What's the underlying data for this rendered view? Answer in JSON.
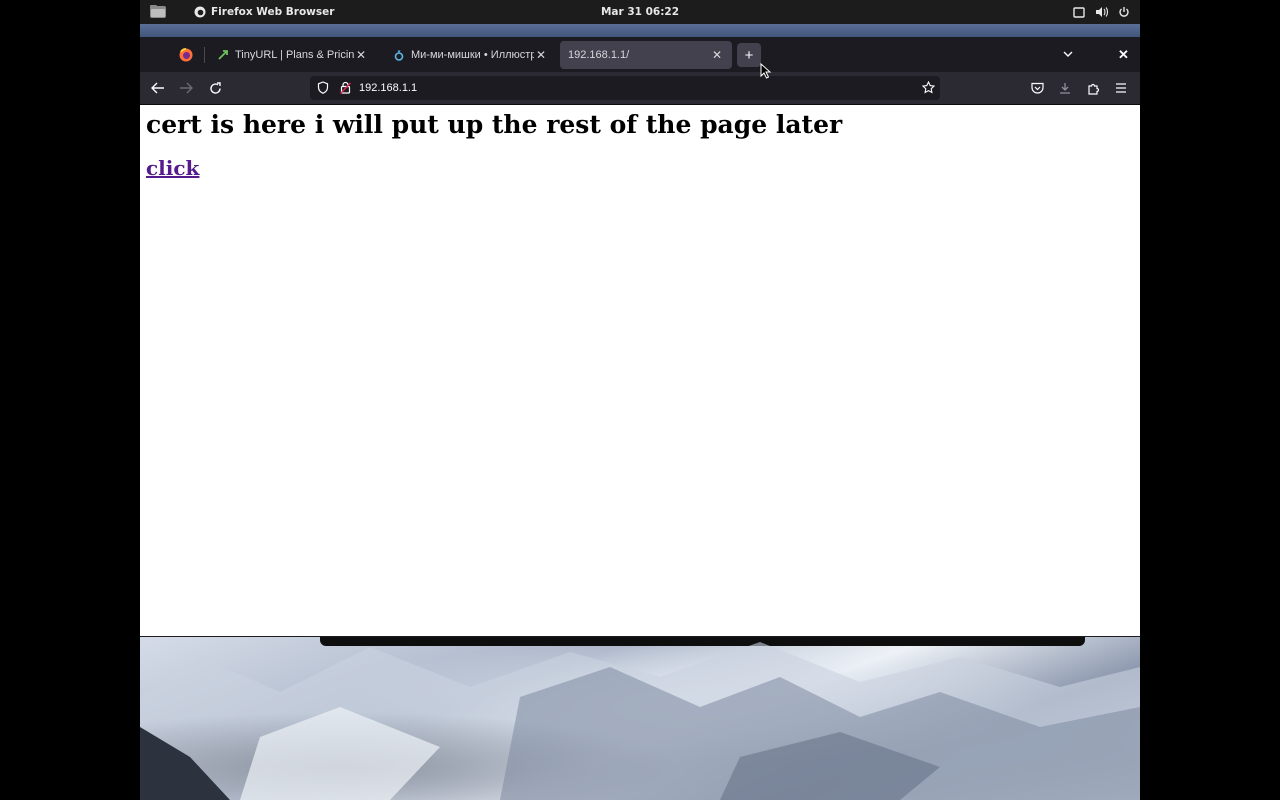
{
  "topbar": {
    "app_name": "Firefox Web Browser",
    "clock": "Mar 31  06:22"
  },
  "tabs": [
    {
      "title": "TinyURL | Plans & Pricing",
      "favicon": "tinyurl-icon",
      "active": false
    },
    {
      "title": "Ми-ми-мишки • Иллюстр",
      "favicon": "ring-icon",
      "active": false
    },
    {
      "title": "192.168.1.1/",
      "favicon": "",
      "active": true
    }
  ],
  "navbar": {
    "url": "192.168.1.1"
  },
  "page": {
    "heading": "cert is here i will put up the rest of the page later",
    "link_text": "click"
  },
  "colors": {
    "link_visited": "#551a8b",
    "tabstrip": "#1c1b22",
    "toolbar": "#2b2a33"
  }
}
